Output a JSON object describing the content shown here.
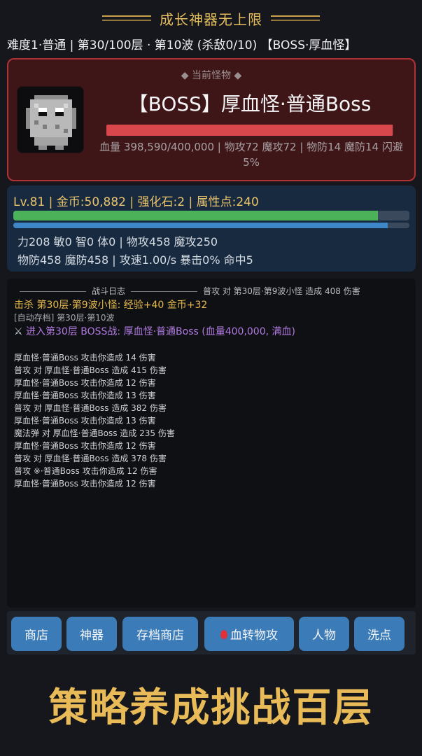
{
  "header": {
    "title": "成长神器无上限"
  },
  "stage": {
    "line": "难度1·普通 | 第30/100层 · 第10波 (杀敌0/10) 【BOSS·厚血怪】"
  },
  "monster": {
    "tag": "◆ 当前怪物 ◆",
    "name": "【BOSS】厚血怪·普通Boss",
    "hp_fraction": 0.9965,
    "stats": "血量 398,590/400,000 | 物攻72 魔攻72 | 物防14 魔防14 闪避5%",
    "avatar_icon": "pixel-monster-icon"
  },
  "player": {
    "header": "Lv.81 | 金币:50,882 | 强化石:2 | 属性点:240",
    "exp_fraction": 0.92,
    "mp_fraction": 0.945,
    "stats_line1": "力208 敏0 智0 体0 | 物攻458 魔攻250",
    "stats_line2": "物防458 魔防458 | 攻速1.00/s 暴击0% 命中5"
  },
  "log": {
    "title": "战斗日志",
    "header_tail": "普攻 对 第30层·第9波小怪 造成 408 伤害",
    "kill": "击杀 第30层·第9波小怪: 经验+40 金币+32",
    "autosave": "[自动存档] 第30层·第10波",
    "enter_icon": "crossed-swords-icon",
    "enter": "进入第30层 BOSS战: 厚血怪·普通Boss (血量400,000, 满血)",
    "entries": [
      "厚血怪·普通Boss 攻击你造成 14 伤害",
      "普攻 对 厚血怪·普通Boss 造成 415 伤害",
      "厚血怪·普通Boss 攻击你造成 12 伤害",
      "厚血怪·普通Boss 攻击你造成 13 伤害",
      "普攻 对 厚血怪·普通Boss 造成 382 伤害",
      "厚血怪·普通Boss 攻击你造成 13 伤害",
      "魔法弹 对 厚血怪·普通Boss 造成 235 伤害",
      "厚血怪·普通Boss 攻击你造成 12 伤害",
      "普攻 对 厚血怪·普通Boss 造成 378 伤害",
      "普攻 ※·普通Boss 攻击你造成 12 伤害",
      "厚血怪·普通Boss 攻击你造成 12 伤害"
    ]
  },
  "toolbar": {
    "shop": "商店",
    "artifact": "神器",
    "save_shop": "存档商店",
    "blood_convert": "血转物攻",
    "blood_icon": "blood-drop-icon",
    "character": "人物",
    "reset": "洗点"
  },
  "slogan": "策略养成挑战百层",
  "colors": {
    "gold": "#e9bb58",
    "boss_red": "#d7474c",
    "button_blue": "#3b7bb7",
    "exp_green": "#4bb25a"
  }
}
